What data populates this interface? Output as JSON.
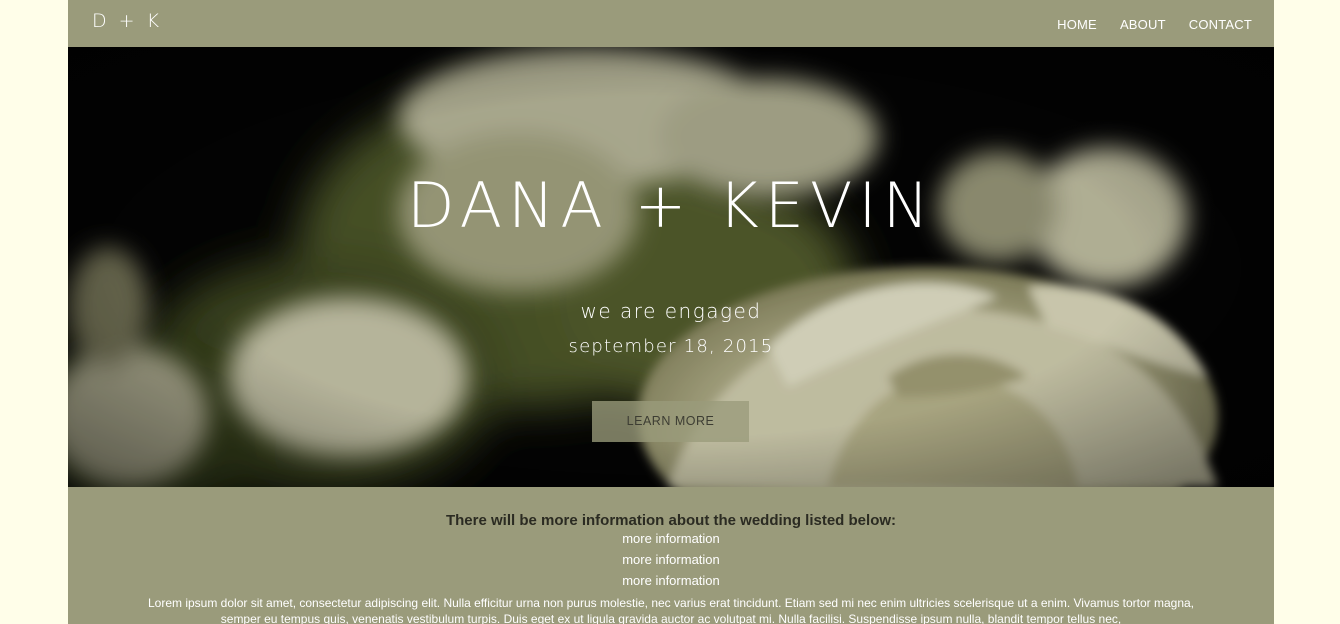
{
  "header": {
    "logo": "D + K",
    "nav": [
      "HOME",
      "ABOUT",
      "CONTACT"
    ]
  },
  "hero": {
    "title": "DANA + KEVIN",
    "subtitle": "we are engaged",
    "date": "september 18, 2015",
    "button_label": "LEARN MORE"
  },
  "info": {
    "heading": "There will be more information about the wedding listed below:",
    "items": [
      "more information",
      "more information",
      "more information"
    ],
    "body": "Lorem ipsum dolor sit amet, consectetur adipiscing elit. Nulla efficitur urna non purus molestie, nec varius erat tincidunt. Etiam sed mi nec enim ultricies scelerisque ut a enim. Vivamus tortor magna, semper eu tempus quis, venenatis vestibulum turpis. Duis eget ex ut ligula gravida auctor ac volutpat mi. Nulla facilisi. Suspendisse ipsum nulla, blandit tempor tellus nec,"
  },
  "colors": {
    "page_background": "#fffee9",
    "panel": "#9a9b7b",
    "heading_text": "#2b2b22",
    "text": "#ffffff"
  }
}
